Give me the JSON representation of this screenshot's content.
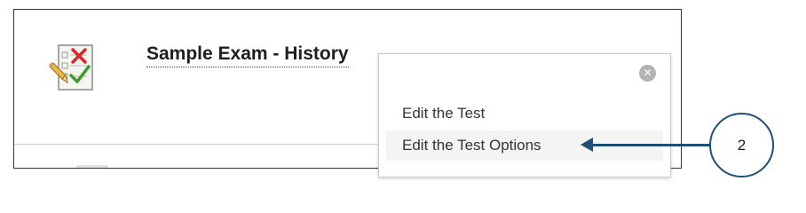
{
  "content": {
    "title": "Sample Exam - History",
    "icon": "test-clipboard-icon"
  },
  "context_menu": {
    "close_icon": "close-circle-icon",
    "close_glyph": "✕",
    "items": [
      {
        "label": "Edit the Test"
      },
      {
        "label": "Edit the Test Options",
        "highlighted": true
      }
    ]
  },
  "annotation": {
    "step_number": "2",
    "color": "#1f4e79"
  }
}
